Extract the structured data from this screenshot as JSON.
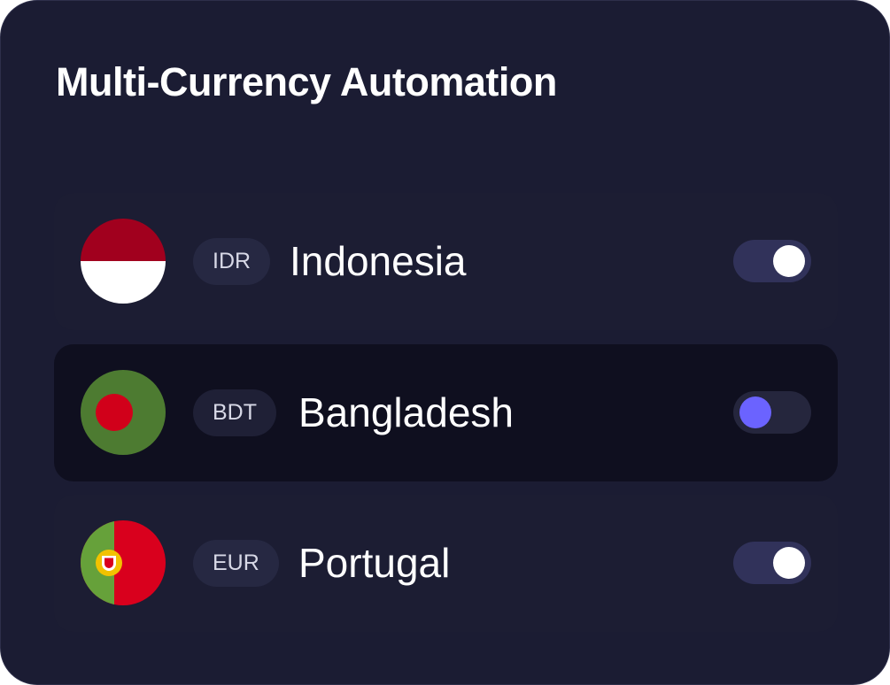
{
  "title": "Multi-Currency Automation",
  "currencies": [
    {
      "code": "IDR",
      "country": "Indonesia",
      "enabled": true,
      "highlighted": false,
      "flag_icon": "indonesia-flag-icon",
      "flag_colors": {
        "top": "#a1001e",
        "bottom": "#ffffff"
      }
    },
    {
      "code": "BDT",
      "country": "Bangladesh",
      "enabled": false,
      "highlighted": true,
      "flag_icon": "bangladesh-flag-icon",
      "flag_colors": {
        "field": "#4d7b31",
        "disc": "#d1001a"
      }
    },
    {
      "code": "EUR",
      "country": "Portugal",
      "enabled": true,
      "highlighted": false,
      "flag_icon": "portugal-flag-icon",
      "flag_colors": {
        "hoist": "#66a13a",
        "fly": "#d9001d",
        "emblem": "#f2c200"
      }
    }
  ],
  "colors": {
    "card_background": "#1b1c33",
    "highlight_row": "#0f0f1f",
    "toggle_on_track": "#31325a",
    "toggle_off_knob": "#6b63ff",
    "text": "#ffffff"
  }
}
